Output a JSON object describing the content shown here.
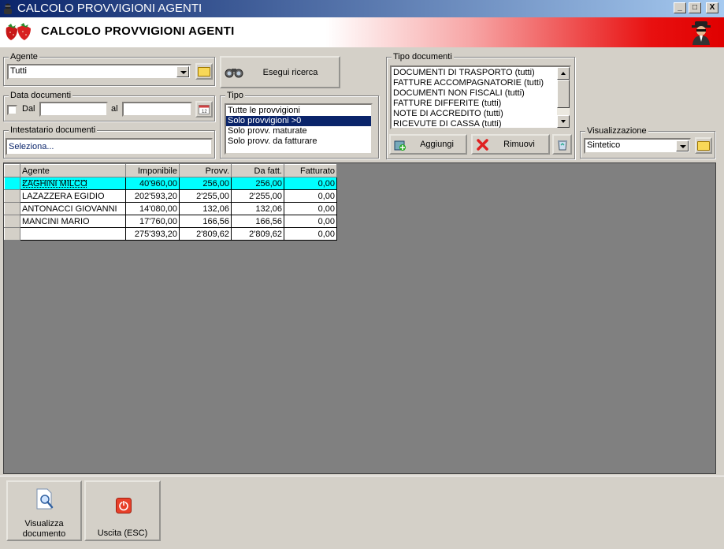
{
  "window": {
    "title": "CALCOLO PROVVIGIONI AGENTI",
    "controls": {
      "minimize": "_",
      "maximize": "□",
      "close": "X"
    }
  },
  "banner": {
    "title": "CALCOLO PROVVIGIONI AGENTI"
  },
  "agente": {
    "label": "Agente",
    "value": "Tutti"
  },
  "data_documenti": {
    "label": "Data documenti",
    "dal_label": "Dal",
    "al_label": "al",
    "dal_value": "",
    "al_value": ""
  },
  "intestatario": {
    "label": "Intestatario documenti",
    "value": "Seleziona..."
  },
  "search_button": {
    "label": "Esegui ricerca"
  },
  "tipo": {
    "label": "Tipo",
    "options": [
      "Tutte le provvigioni",
      "Solo provvigioni >0",
      "Solo provv. maturate",
      "Solo provv. da fatturare"
    ],
    "selected_index": 1
  },
  "tipo_documenti": {
    "label": "Tipo documenti",
    "items": [
      "DOCUMENTI DI TRASPORTO (tutti)",
      "FATTURE ACCOMPAGNATORIE (tutti)",
      "DOCUMENTI NON FISCALI (tutti)",
      "FATTURE DIFFERITE (tutti)",
      "NOTE DI ACCREDITO (tutti)",
      "RICEVUTE DI CASSA (tutti)"
    ],
    "add_label": "Aggiungi",
    "remove_label": "Rimuovi"
  },
  "visualizzazione": {
    "label": "Visualizzazione",
    "value": "Sintetico"
  },
  "grid": {
    "columns": [
      "Agente",
      "Imponibile",
      "Provv.",
      "Da fatt.",
      "Fatturato"
    ],
    "rows": [
      [
        "ZAGHINI MILCO",
        "40'960,00",
        "256,00",
        "256,00",
        "0,00"
      ],
      [
        "LAZAZZERA EGIDIO",
        "202'593,20",
        "2'255,00",
        "2'255,00",
        "0,00"
      ],
      [
        "ANTONACCI GIOVANNI",
        "14'080,00",
        "132,06",
        "132,06",
        "0,00"
      ],
      [
        "MANCINI MARIO",
        "17'760,00",
        "166,56",
        "166,56",
        "0,00"
      ]
    ],
    "totals": [
      "",
      "275'393,20",
      "2'809,62",
      "2'809,62",
      "0,00"
    ],
    "highlight_color": "#00ffff"
  },
  "footer": {
    "view_document_line1": "Visualizza",
    "view_document_line2": "documento",
    "exit_label": "Uscita (ESC)"
  }
}
